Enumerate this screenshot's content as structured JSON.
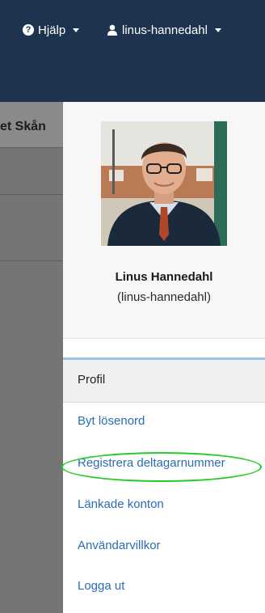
{
  "navbar": {
    "help_label": "Hjälp",
    "user_label": "linus-hannedahl"
  },
  "background_page": {
    "title_fragment": "et Skån"
  },
  "profile": {
    "display_name": "Linus Hannedahl",
    "username": "(linus-hannedahl)"
  },
  "menu": {
    "items": [
      {
        "label": "Profil",
        "active": true
      },
      {
        "label": "Byt lösenord"
      },
      {
        "label": "Registrera deltagarnummer",
        "highlighted": true
      },
      {
        "label": "Länkade konton"
      },
      {
        "label": "Användarvillkor"
      },
      {
        "label": "Logga ut"
      }
    ]
  },
  "colors": {
    "navbar": "#1e3350",
    "link": "#2a6db4",
    "highlight_oval": "#22cc22"
  }
}
